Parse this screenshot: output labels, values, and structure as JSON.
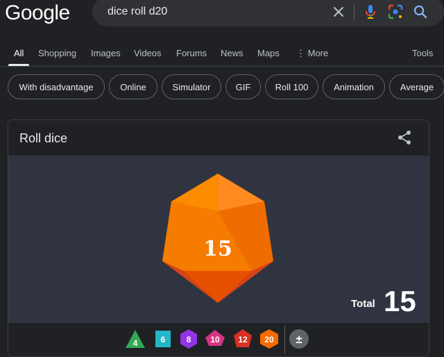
{
  "logo": "Google",
  "search": {
    "query": "dice roll d20"
  },
  "tabs": [
    "All",
    "Shopping",
    "Images",
    "Videos",
    "Forums",
    "News",
    "Maps",
    "More"
  ],
  "tools_label": "Tools",
  "chips": [
    "With disadvantage",
    "Online",
    "Simulator",
    "GIF",
    "Roll 100",
    "Animation",
    "Average"
  ],
  "card": {
    "title": "Roll dice",
    "die_result": "15",
    "total_label": "Total",
    "total_value": "15"
  },
  "dice": [
    {
      "label": "4",
      "color": "#34a853",
      "shape": "triangle"
    },
    {
      "label": "6",
      "color": "#24b6c9",
      "shape": "square"
    },
    {
      "label": "8",
      "color": "#9334e6",
      "shape": "hexagon"
    },
    {
      "label": "10",
      "color": "#d63384",
      "shape": "diamond"
    },
    {
      "label": "12",
      "color": "#d93025",
      "shape": "pentagon"
    },
    {
      "label": "20",
      "color": "#f56b00",
      "shape": "hexagon"
    },
    {
      "label": "±",
      "color": "#5f6368",
      "shape": "circle"
    }
  ],
  "colors": {
    "background": "#202124",
    "surface": "#303134",
    "stage": "#303440",
    "d20_main": "#f57c00",
    "d20_dark": "#e65100"
  }
}
